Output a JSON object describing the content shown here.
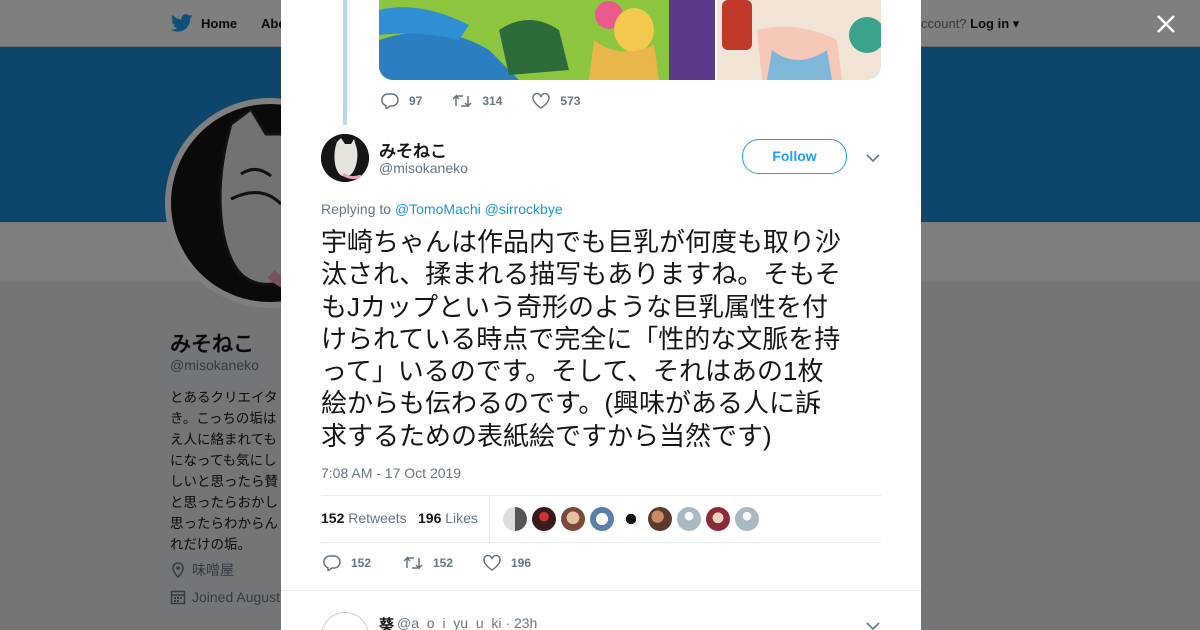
{
  "nav": {
    "home_label": "Home",
    "about_label": "Abo",
    "account_text": "ccount?",
    "login_label": "Log in"
  },
  "profile": {
    "name": "みそねこ",
    "handle": "@misokaneko",
    "bio_lines": [
      "とあるクリエイタ",
      "き。こっちの垢は",
      "え人に絡まれても",
      "になっても気にし",
      "しいと思ったら賛",
      "と思ったらおかし",
      "思ったらわからん",
      "れだけの垢。"
    ],
    "location": "味噌屋",
    "joined": "Joined August"
  },
  "previous_tweet": {
    "replies": "97",
    "retweets": "314",
    "likes": "573"
  },
  "tweet": {
    "author_name": "みそねこ",
    "author_handle": "@misokaneko",
    "follow_label": "Follow",
    "replying_prefix": "Replying to",
    "mention_1": "@TomoMachi",
    "mention_2": "@sirrockbye",
    "text_lines": [
      "宇崎ちゃんは作品内でも巨乳が何度も取り沙",
      "汰され、揉まれる描写もありますね。そもそ",
      "もJカップという奇形のような巨乳属性を付",
      "けられている時点で完全に「性的な文脈を持",
      "って」いるのです。そして、それはあの1枚",
      "絵からも伝わるのです。(興味がある人に訴",
      "求するための表紙絵ですから当然です)"
    ],
    "timestamp": "7:08 AM - 17 Oct 2019",
    "retweet_count": "152",
    "retweet_label": "Retweets",
    "like_count": "196",
    "like_label": "Likes",
    "action_replies": "152",
    "action_retweets": "152",
    "action_likes": "196"
  },
  "next_reply": {
    "name": "葵",
    "meta": "@a_o_i_yu_u_ki · 23h"
  },
  "colors": {
    "accent": "#1da1f2",
    "banner": "#1d8dd6",
    "text": "#14171a",
    "muted": "#657786"
  },
  "icons": [
    "twitter-bird-icon",
    "close-icon",
    "reply-icon",
    "retweet-icon",
    "heart-icon",
    "chevron-down-icon",
    "location-icon",
    "calendar-icon"
  ]
}
